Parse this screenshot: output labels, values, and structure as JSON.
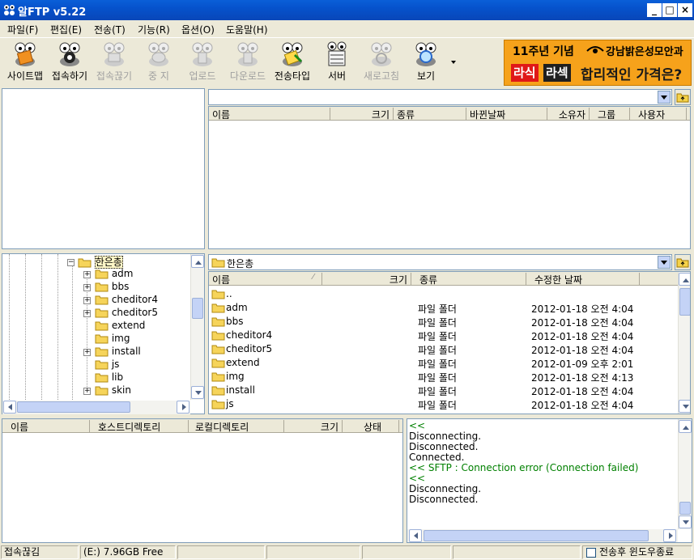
{
  "window": {
    "title": "알FTP v5.22"
  },
  "menu": [
    "파일(F)",
    "편집(E)",
    "전송(T)",
    "기능(R)",
    "옵션(O)",
    "도움말(H)"
  ],
  "toolbar": [
    {
      "label": "사이트맵",
      "icon": "sitemap-icon",
      "enabled": true
    },
    {
      "label": "접속하기",
      "icon": "connect-icon",
      "enabled": true
    },
    {
      "label": "접속끊기",
      "icon": "disconnect-icon",
      "enabled": false
    },
    {
      "label": "중 지",
      "icon": "stop-icon",
      "enabled": false
    },
    {
      "label": "업로드",
      "icon": "upload-icon",
      "enabled": false
    },
    {
      "label": "다운로드",
      "icon": "download-icon",
      "enabled": false
    },
    {
      "label": "전송타입",
      "icon": "transfer-type-icon",
      "enabled": true
    },
    {
      "label": "서버",
      "icon": "server-icon",
      "enabled": true
    },
    {
      "label": "새로고침",
      "icon": "refresh-icon",
      "enabled": false
    },
    {
      "label": "보기",
      "icon": "view-icon",
      "enabled": true
    }
  ],
  "ad": {
    "line1": "11주년 기념",
    "line2": "강남밝은성모안과",
    "tag1": "라식",
    "tag2": "라섹",
    "slogan": "합리적인 가격은?"
  },
  "remote": {
    "path": "",
    "columns": [
      "이름",
      "크기",
      "종류",
      "바뀐날짜",
      "소유자",
      "그룹",
      "사용자"
    ]
  },
  "local": {
    "path": "한은총",
    "columns": [
      "이름",
      "크기",
      "종류",
      "수정한 날짜"
    ],
    "files": [
      {
        "name": "..",
        "type": "",
        "date": ""
      },
      {
        "name": "adm",
        "type": "파일 폴더",
        "date": "2012-01-18 오전 4:04"
      },
      {
        "name": "bbs",
        "type": "파일 폴더",
        "date": "2012-01-18 오전 4:04"
      },
      {
        "name": "cheditor4",
        "type": "파일 폴더",
        "date": "2012-01-18 오전 4:04"
      },
      {
        "name": "cheditor5",
        "type": "파일 폴더",
        "date": "2012-01-18 오전 4:04"
      },
      {
        "name": "extend",
        "type": "파일 폴더",
        "date": "2012-01-09 오후 2:01"
      },
      {
        "name": "img",
        "type": "파일 폴더",
        "date": "2012-01-18 오전 4:13"
      },
      {
        "name": "install",
        "type": "파일 폴더",
        "date": "2012-01-18 오전 4:04"
      },
      {
        "name": "js",
        "type": "파일 폴더",
        "date": "2012-01-18 오전 4:04"
      }
    ]
  },
  "tree": {
    "root": "한은총",
    "items": [
      {
        "name": "adm",
        "expandable": true
      },
      {
        "name": "bbs",
        "expandable": true
      },
      {
        "name": "cheditor4",
        "expandable": true
      },
      {
        "name": "cheditor5",
        "expandable": true
      },
      {
        "name": "extend",
        "expandable": false
      },
      {
        "name": "img",
        "expandable": false
      },
      {
        "name": "install",
        "expandable": true
      },
      {
        "name": "js",
        "expandable": false
      },
      {
        "name": "lib",
        "expandable": false
      },
      {
        "name": "skin",
        "expandable": true
      }
    ]
  },
  "queue": {
    "columns": [
      "이름",
      "호스트디렉토리",
      "로컬디렉토리",
      "크기",
      "상태"
    ]
  },
  "log": [
    {
      "text": "<<",
      "color": "#008000"
    },
    {
      "text": "Disconnecting.",
      "color": "#000000"
    },
    {
      "text": "Disconnected.",
      "color": "#000000"
    },
    {
      "text": "Connected.",
      "color": "#000000"
    },
    {
      "text": "<< SFTP : Connection error (Connection failed)",
      "color": "#008000"
    },
    {
      "text": "<<",
      "color": "#008000"
    },
    {
      "text": "Disconnecting.",
      "color": "#000000"
    },
    {
      "text": "Disconnected.",
      "color": "#000000"
    }
  ],
  "status": {
    "connection": "접속끊김",
    "drive": "(E:)  7.96GB Free",
    "close_after": "전송후 윈도우종료"
  }
}
